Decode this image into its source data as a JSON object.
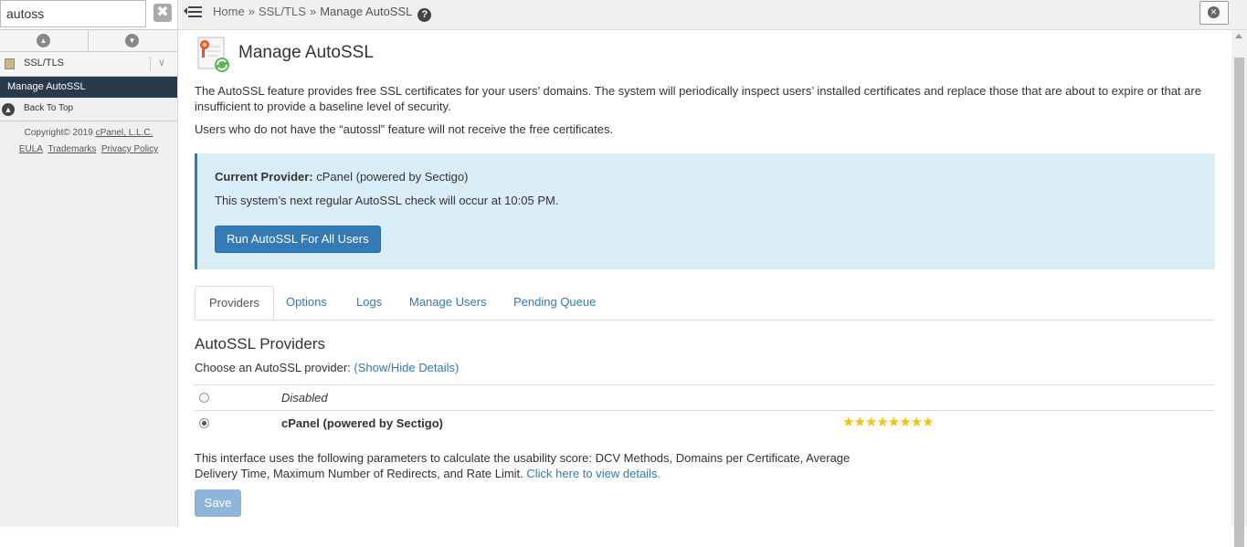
{
  "sidebar": {
    "search_value": "autoss",
    "search_clear_glyph": "✖",
    "category_label": "SSL/TLS",
    "category_chevron": "∨",
    "active_item": "Manage AutoSSL",
    "back_to_top": "Back To Top",
    "copyright_prefix": "Copyright© 2019 ",
    "copyright_company": "cPanel, L.L.C.",
    "footer_links": [
      "EULA",
      "Trademarks",
      "Privacy Policy"
    ]
  },
  "breadcrumb": {
    "home": "Home",
    "separator": "»",
    "section": "SSL/TLS",
    "current": "Manage AutoSSL",
    "help_glyph": "?"
  },
  "page": {
    "title": "Manage AutoSSL",
    "description": "The AutoSSL feature provides free SSL certificates for your users’ domains. The system will periodically inspect users’ installed certificates and replace those that are about to expire or that are insufficient to provide a baseline level of security.",
    "feature_note": "Users who do not have the “autossl” feature will not receive the free certificates."
  },
  "provider_box": {
    "current_label": "Current Provider:",
    "current_value": " cPanel (powered by Sectigo)",
    "check_text": "This system’s next regular AutoSSL check will occur at 10:05 PM.",
    "run_button": "Run AutoSSL For All Users"
  },
  "tabs": [
    {
      "label": "Providers",
      "active": true
    },
    {
      "label": "Options",
      "active": false
    },
    {
      "label": "Logs",
      "active": false
    },
    {
      "label": "Manage Users",
      "active": false
    },
    {
      "label": "Pending Queue",
      "active": false
    }
  ],
  "providers": {
    "heading": "AutoSSL Providers",
    "choose_label": "Choose an AutoSSL provider: ",
    "details_link": "(Show/Hide Details)",
    "rows": [
      {
        "name": "Disabled",
        "selected": false
      },
      {
        "name": "cPanel (powered by Sectigo)",
        "selected": true,
        "rating": 8
      }
    ],
    "stars": "★★★★★★★★"
  },
  "usability": {
    "text": "This interface uses the following parameters to calculate the usability score: DCV Methods, Domains per Certificate, Average Delivery Time, Maximum Number of Redirects, and Rate Limit. ",
    "link": "Click here to view details."
  },
  "save_button": "Save",
  "colors": {
    "accent": "#337ab7",
    "info_bg": "#d9edf7",
    "sidebar_active_bg": "#293a4a",
    "star": "#f4c20d"
  },
  "icons": [
    "search-clear-icon",
    "chevron-up-icon",
    "chevron-down-icon",
    "ssl-category-icon",
    "back-to-top-icon",
    "menu-toggle-icon",
    "help-icon",
    "close-icon",
    "certificate-icon",
    "star-icon"
  ]
}
